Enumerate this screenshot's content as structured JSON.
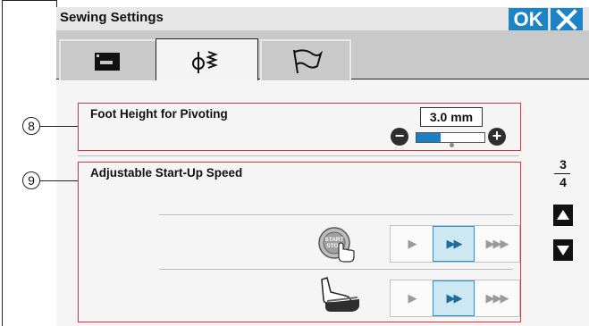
{
  "window": {
    "title": "Sewing Settings",
    "ok_label": "OK"
  },
  "tabs": [
    {
      "icon": "sewing-machine-icon"
    },
    {
      "icon": "stitch-icon",
      "active": true
    },
    {
      "icon": "flag-icon"
    }
  ],
  "callouts": {
    "foot_height": "8",
    "start_speed": "9"
  },
  "foot_height": {
    "label": "Foot Height for Pivoting",
    "value": "3.0 mm",
    "minus": "−",
    "plus": "+",
    "level_fraction": 0.35
  },
  "start_speed": {
    "label": "Adjustable Start-Up Speed",
    "start_stop": {
      "line1": "START",
      "line2": "STOP",
      "options": [
        "▶",
        "▶▶",
        "▶▶▶"
      ],
      "selected": 1
    },
    "foot_control": {
      "options": [
        "▶",
        "▶▶",
        "▶▶▶"
      ],
      "selected": 1
    }
  },
  "pagination": {
    "current": "3",
    "total": "4"
  },
  "colors": {
    "accent": "#1b83c6",
    "highlight": "#e0323a",
    "selected_bg": "#cde7f3"
  }
}
